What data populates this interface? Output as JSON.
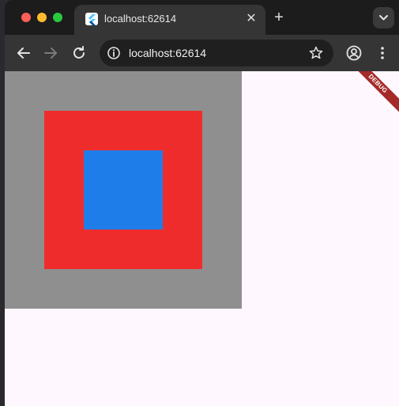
{
  "browser": {
    "tab": {
      "title": "localhost:62614",
      "close_glyph": "✕",
      "favicon": "flutter-icon"
    },
    "new_tab_glyph": "+",
    "address_bar": {
      "url": "localhost:62614"
    },
    "icons": {
      "back": "arrow-left-icon",
      "forward": "arrow-right-icon",
      "reload": "reload-icon",
      "info": "info-icon",
      "bookmark": "star-icon",
      "profile": "profile-icon",
      "menu": "kebab-menu-icon",
      "tab_search": "chevron-down-icon"
    }
  },
  "app": {
    "debug_banner": "DEBUG",
    "colors": {
      "background": "#fff7fe",
      "outer_box": "#8f8f8f",
      "middle_box": "#ef2c2c",
      "inner_box": "#1f7de9",
      "banner": "#a52a2a"
    }
  }
}
